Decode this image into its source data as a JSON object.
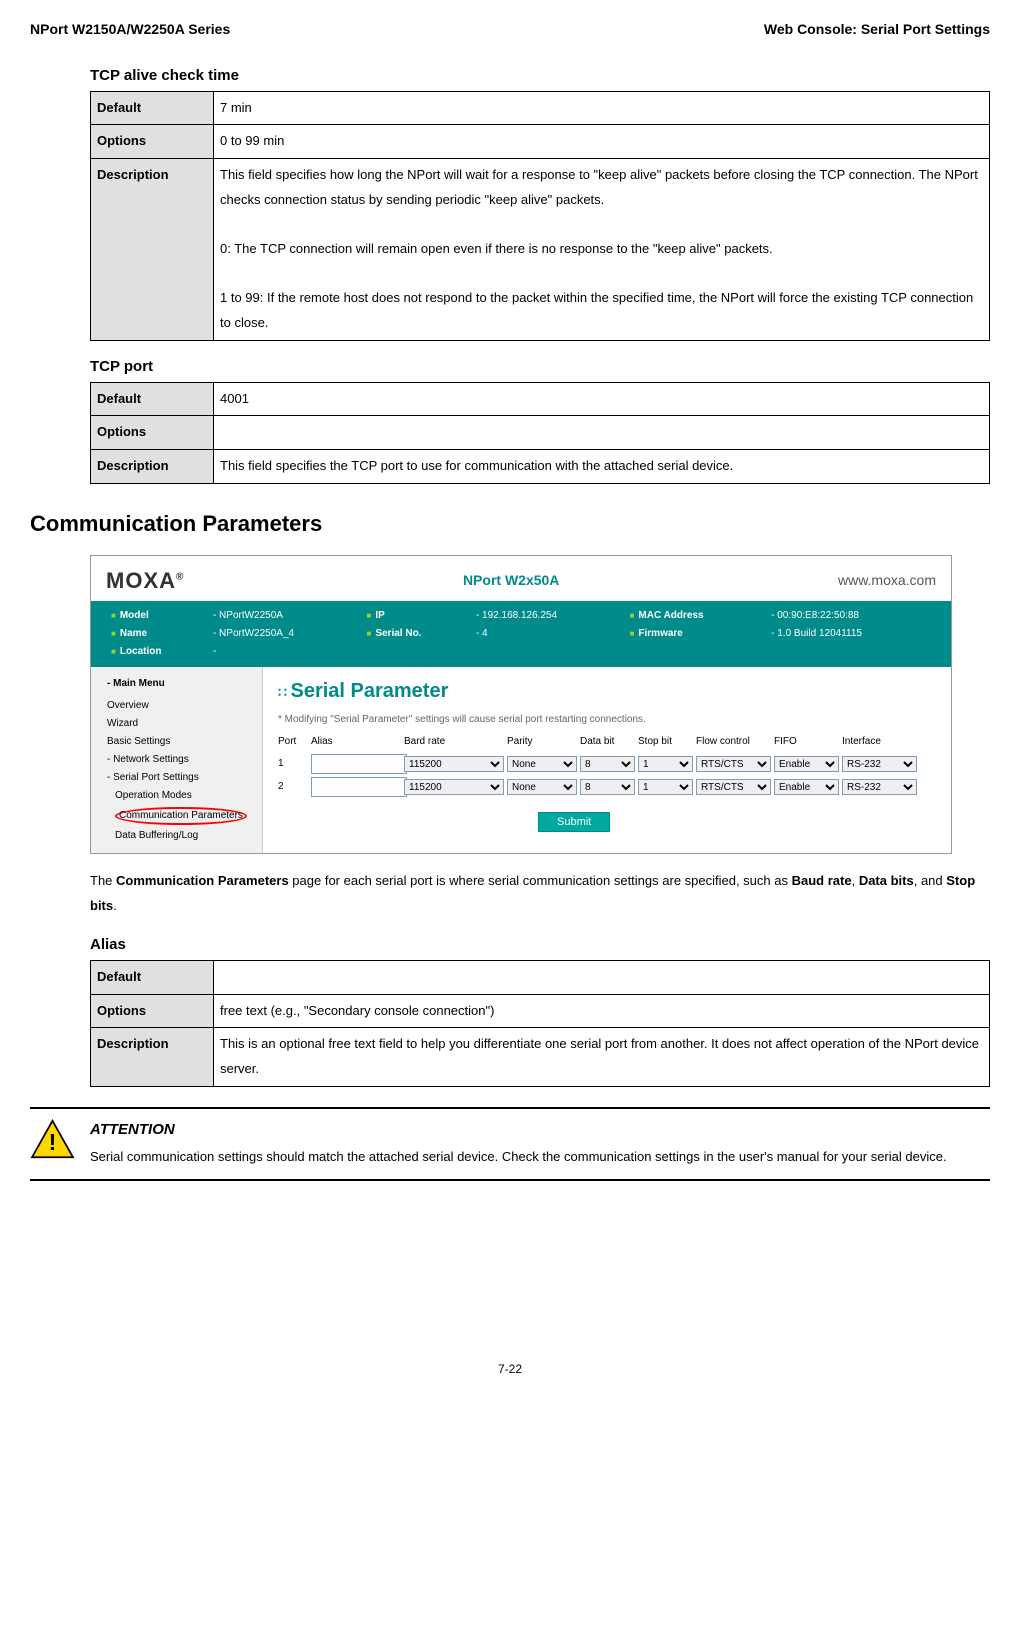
{
  "header": {
    "left": "NPort W2150A/W2250A Series",
    "right": "Web Console: Serial Port Settings"
  },
  "tcp_alive": {
    "title": "TCP alive check time",
    "default_label": "Default",
    "default_value": "7 min",
    "options_label": "Options",
    "options_value": "0 to 99 min",
    "description_label": "Description",
    "description_p1": "This field specifies how long the NPort will wait for a response to \"keep alive\" packets before closing the TCP connection. The NPort checks connection status by sending periodic \"keep alive\" packets.",
    "description_p2": "0: The TCP connection will remain open even if there is no response to the \"keep alive\" packets.",
    "description_p3": "1 to 99: If the remote host does not respond to the packet within the specified time, the NPort will force the existing TCP connection to close."
  },
  "tcp_port": {
    "title": "TCP port",
    "default_label": "Default",
    "default_value": "4001",
    "options_label": "Options",
    "options_value": "",
    "description_label": "Description",
    "description_value": "This field specifies the TCP port to use for communication with the attached serial device."
  },
  "comm_params": {
    "title": "Communication Parameters",
    "body_text_1": "The ",
    "body_bold_1": "Communication Parameters",
    "body_text_2": " page for each serial port is where serial communication settings are specified, such as ",
    "body_bold_2": "Baud rate",
    "body_text_3": ", ",
    "body_bold_3": "Data bits",
    "body_text_4": ", and ",
    "body_bold_4": "Stop bits",
    "body_text_5": "."
  },
  "screenshot": {
    "logo": "MOXA",
    "title": "NPort W2x50A",
    "url": "www.moxa.com",
    "info": {
      "model_l": "Model",
      "model_v": "- NPortW2250A",
      "name_l": "Name",
      "name_v": "- NPortW2250A_4",
      "location_l": "Location",
      "location_v": "-",
      "ip_l": "IP",
      "ip_v": "- 192.168.126.254",
      "serial_l": "Serial No.",
      "serial_v": "- 4",
      "mac_l": "MAC Address",
      "mac_v": "- 00:90:E8:22:50:88",
      "fw_l": "Firmware",
      "fw_v": "- 1.0 Build 12041115"
    },
    "nav": {
      "title": "- Main Menu",
      "items": [
        "Overview",
        "Wizard",
        "Basic Settings",
        "- Network Settings",
        "- Serial Port Settings"
      ],
      "subitems": [
        "Operation Modes",
        "Communication Parameters",
        "Data Buffering/Log"
      ]
    },
    "content": {
      "heading": "Serial Parameter",
      "note": "* Modifying \"Serial Parameter\" settings will cause serial port restarting connections.",
      "headers": [
        "Port",
        "Alias",
        "Bard rate",
        "Parity",
        "Data bit",
        "Stop bit",
        "Flow control",
        "FIFO",
        "Interface"
      ],
      "row1": {
        "port": "1",
        "baud": "115200",
        "parity": "None",
        "databit": "8",
        "stopbit": "1",
        "flow": "RTS/CTS",
        "fifo": "Enable",
        "iface": "RS-232"
      },
      "row2": {
        "port": "2",
        "baud": "115200",
        "parity": "None",
        "databit": "8",
        "stopbit": "1",
        "flow": "RTS/CTS",
        "fifo": "Enable",
        "iface": "RS-232"
      },
      "submit": "Submit"
    }
  },
  "alias": {
    "title": "Alias",
    "default_label": "Default",
    "default_value": "",
    "options_label": "Options",
    "options_value": "free text (e.g., \"Secondary console connection\")",
    "description_label": "Description",
    "description_value": "This is an optional free text field to help you differentiate one serial port from another. It does not affect operation of the NPort device server."
  },
  "attention": {
    "title": "ATTENTION",
    "text": "Serial communication settings should match the attached serial device. Check the communication settings in the user's manual for your serial device."
  },
  "page_num": "7-22"
}
